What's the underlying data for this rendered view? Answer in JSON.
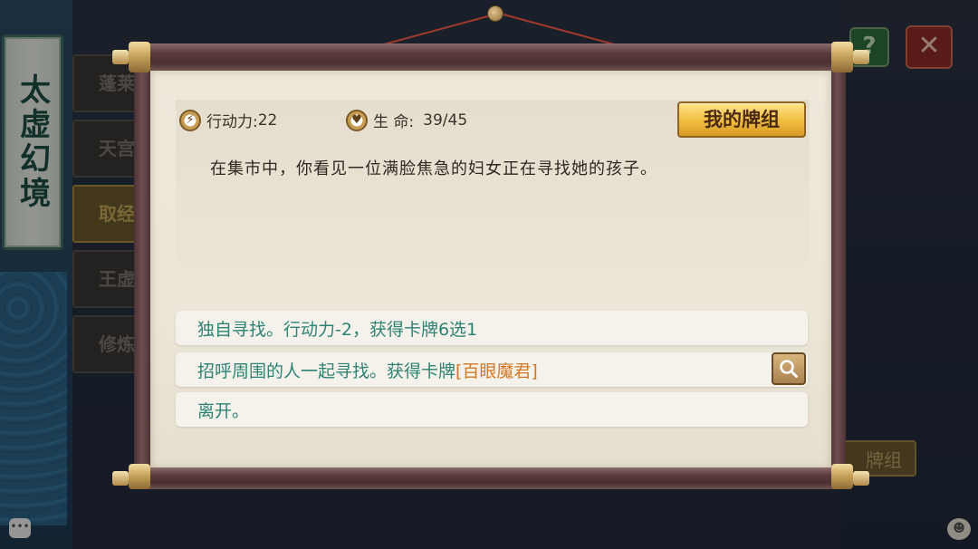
{
  "background": {
    "banner_title": "太虚幻境",
    "side_tabs": [
      "蓬莱",
      "天宫",
      "取经",
      "王虚",
      "修炼"
    ],
    "corner_help": "?",
    "corner_close": "✕",
    "bg_deck_label": "牌组"
  },
  "stats": {
    "action_label": "行动力:",
    "action_value": "22",
    "life_label": "生 命:",
    "life_value": "39/45"
  },
  "deck_button": "我的牌组",
  "story_text": "在集市中，你看见一位满脸焦急的妇女正在寻找她的孩子。",
  "options": [
    {
      "text": "独自寻找。行动力-2，获得卡牌6选1",
      "card": ""
    },
    {
      "text": "招呼周围的人一起寻找。获得卡牌",
      "card": "[百眼魔君]"
    },
    {
      "text": "离开。",
      "card": ""
    }
  ],
  "icons": {
    "action": "lightning-icon",
    "life": "heart-icon",
    "search": "search-icon",
    "chat": "chat-icon",
    "friends": "friends-icon"
  },
  "colors": {
    "option_text": "#2d8372",
    "card_name": "#d4781f",
    "deck_button": "#f0bd3e"
  }
}
